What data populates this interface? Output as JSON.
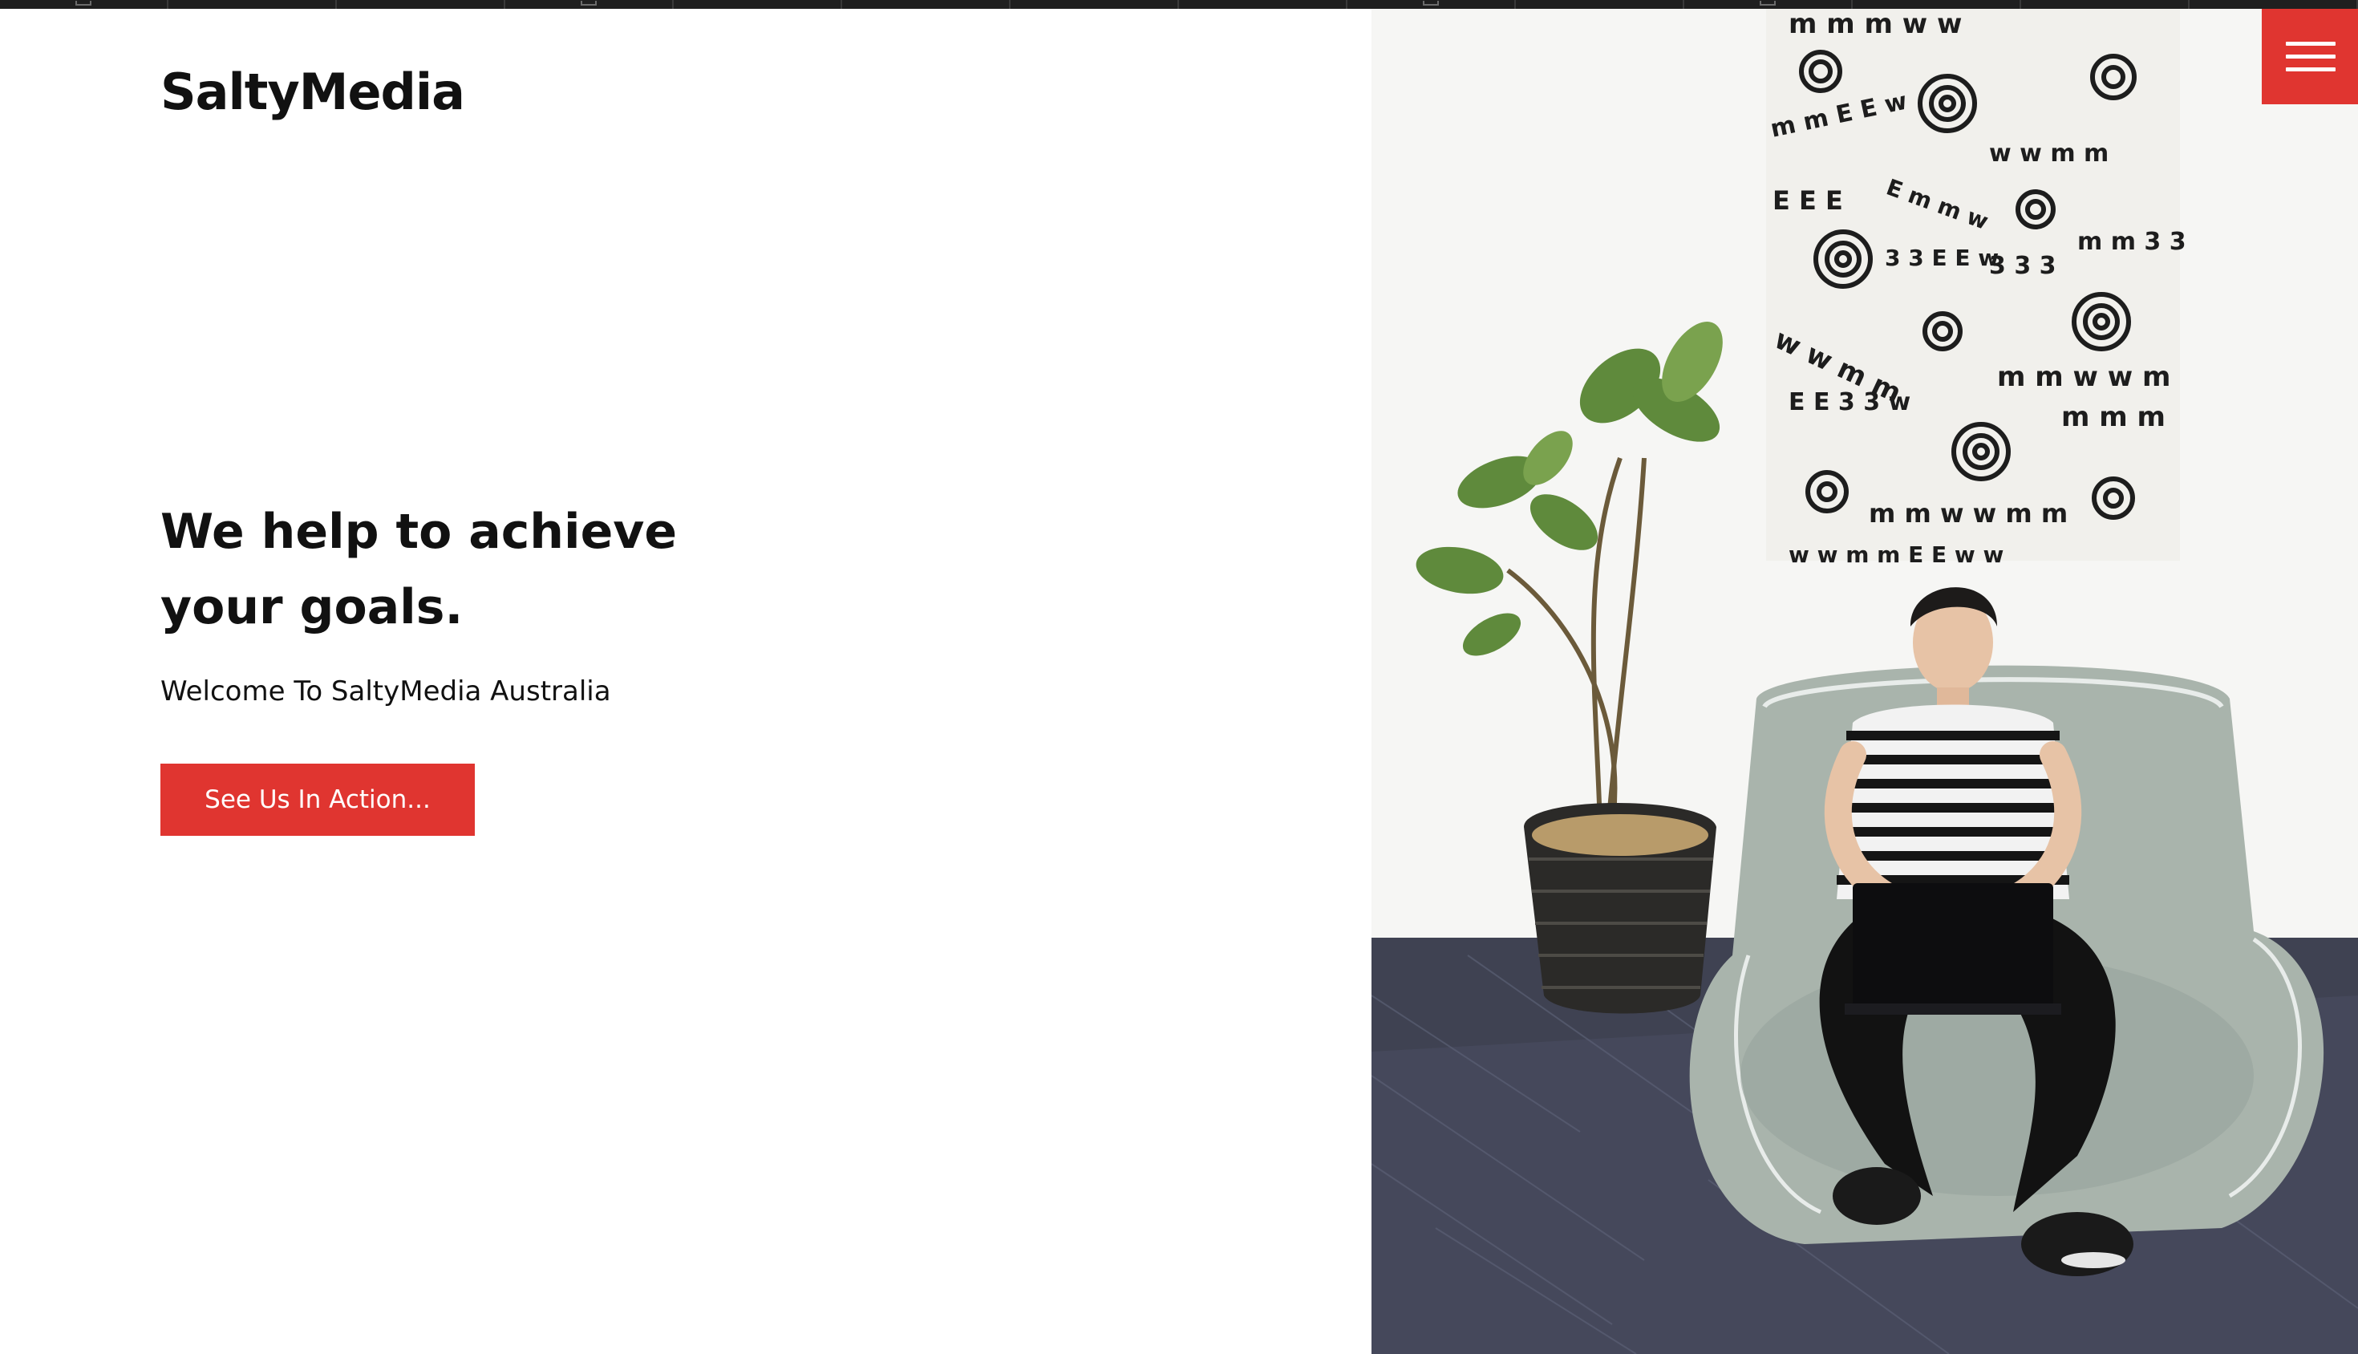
{
  "brand": {
    "name": "SaltyMedia",
    "accent_color": "#e03530"
  },
  "hero": {
    "heading_line1": "We help to achieve",
    "heading_line2": "your goals.",
    "subheading": "Welcome To SaltyMedia Australia",
    "cta_label": "See Us In Action..."
  },
  "menu": {
    "icon": "hamburger-icon"
  },
  "image": {
    "subject": "man with laptop on bean bag beside potted fiddle-leaf fig under patterned wall hanging"
  }
}
